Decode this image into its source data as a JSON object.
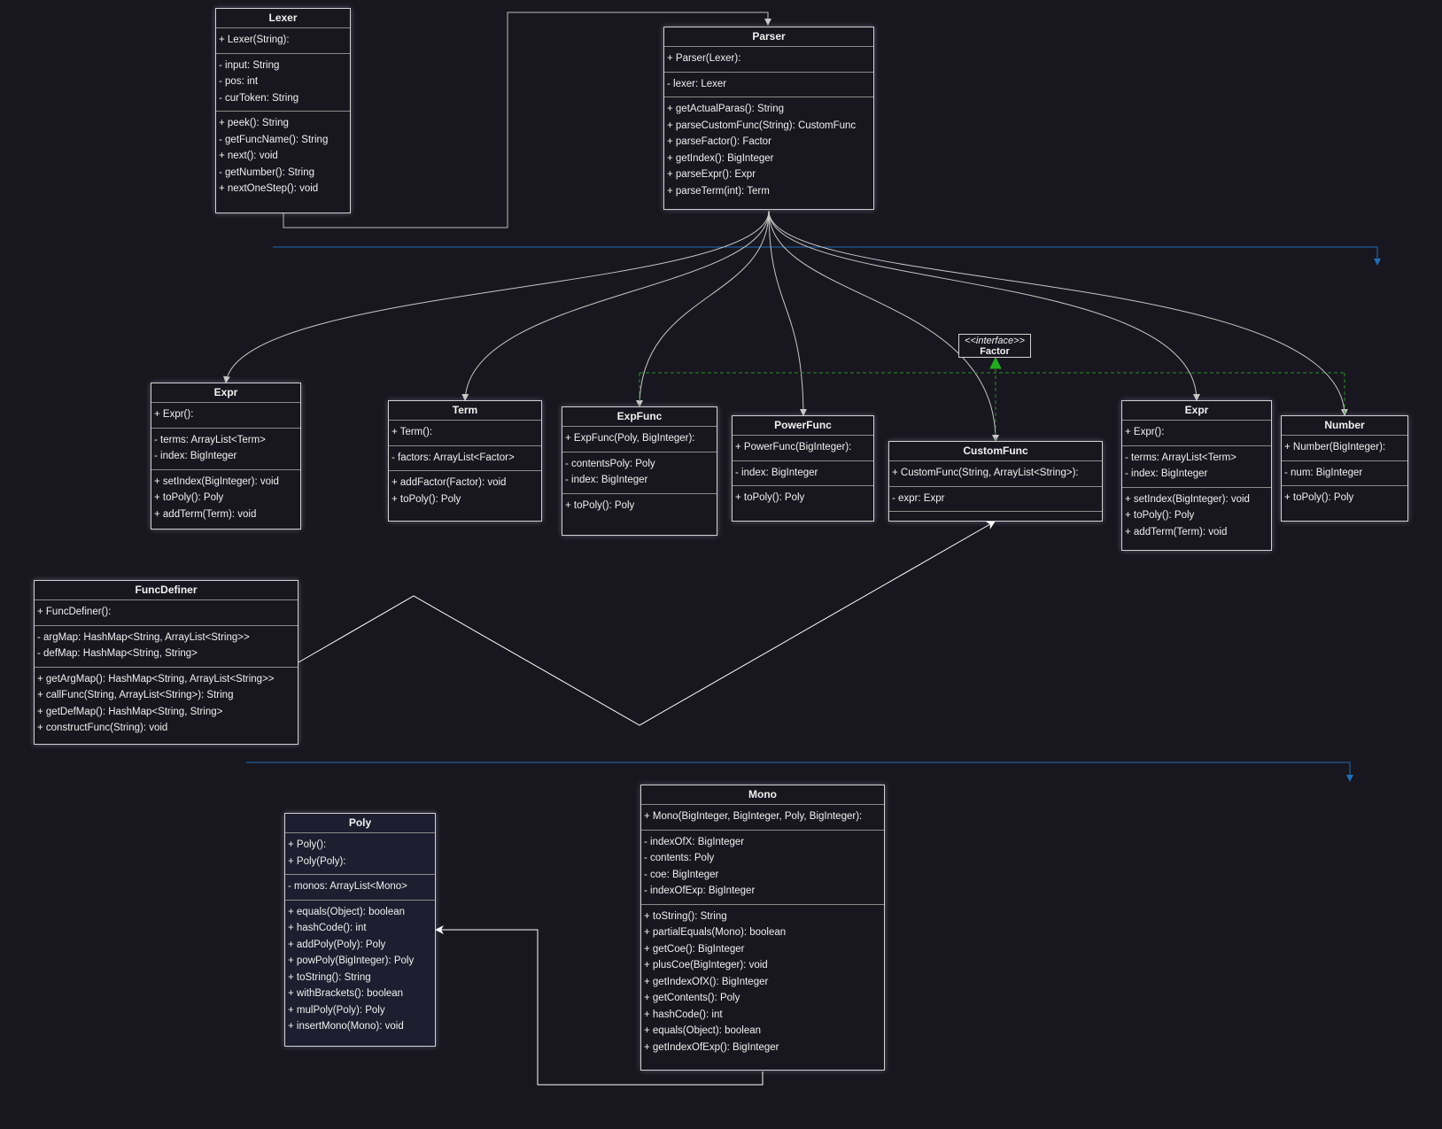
{
  "interface": {
    "stereotype": "<<interface>>",
    "name": "Factor"
  },
  "classes": [
    {
      "name": "Lexer",
      "sections": [
        [
          "+ Lexer(String):"
        ],
        [
          "- input: String",
          "- pos: int",
          "- curToken: String"
        ],
        [
          "+ peek(): String",
          "- getFuncName(): String",
          "+ next(): void",
          "- getNumber(): String",
          "+ nextOneStep(): void"
        ]
      ]
    },
    {
      "name": "Parser",
      "sections": [
        [
          "+ Parser(Lexer):"
        ],
        [
          "- lexer: Lexer"
        ],
        [
          "+ getActualParas(): String",
          "+ parseCustomFunc(String): CustomFunc",
          "+ parseFactor(): Factor",
          "+ getIndex(): BigInteger",
          "+ parseExpr(): Expr",
          "+ parseTerm(int): Term"
        ]
      ]
    },
    {
      "name": "Expr",
      "sections": [
        [
          "+ Expr():"
        ],
        [
          "- terms: ArrayList<Term>",
          "- index: BigInteger"
        ],
        [
          "+ setIndex(BigInteger): void",
          "+ toPoly(): Poly",
          "+ addTerm(Term): void"
        ]
      ]
    },
    {
      "name": "Term",
      "sections": [
        [
          "+ Term():"
        ],
        [
          "- factors: ArrayList<Factor>"
        ],
        [
          "+ addFactor(Factor): void",
          "+ toPoly(): Poly"
        ]
      ]
    },
    {
      "name": "ExpFunc",
      "sections": [
        [
          "+ ExpFunc(Poly, BigInteger):"
        ],
        [
          "- contentsPoly: Poly",
          "- index: BigInteger"
        ],
        [
          "+ toPoly(): Poly"
        ]
      ]
    },
    {
      "name": "PowerFunc",
      "sections": [
        [
          "+ PowerFunc(BigInteger):"
        ],
        [
          "- index: BigInteger"
        ],
        [
          "+ toPoly(): Poly"
        ]
      ]
    },
    {
      "name": "CustomFunc",
      "sections": [
        [
          "+ CustomFunc(String, ArrayList<String>):"
        ],
        [
          "- expr: Expr"
        ],
        []
      ]
    },
    {
      "name": "Expr",
      "sections": [
        [
          "+ Expr():"
        ],
        [
          "- terms: ArrayList<Term>",
          "- index: BigInteger"
        ],
        [
          "+ setIndex(BigInteger): void",
          "+ toPoly(): Poly",
          "+ addTerm(Term): void"
        ]
      ]
    },
    {
      "name": "Number",
      "sections": [
        [
          "+ Number(BigInteger):"
        ],
        [
          "- num: BigInteger"
        ],
        [
          "+ toPoly(): Poly"
        ]
      ]
    },
    {
      "name": "FuncDefiner",
      "sections": [
        [
          "+ FuncDefiner():"
        ],
        [
          "- argMap: HashMap<String, ArrayList<String>>",
          "- defMap: HashMap<String, String>"
        ],
        [
          "+ getArgMap(): HashMap<String, ArrayList<String>>",
          "+ callFunc(String, ArrayList<String>): String",
          "+ getDefMap(): HashMap<String, String>",
          "+ constructFunc(String): void"
        ]
      ]
    },
    {
      "name": "Poly",
      "sections": [
        [
          "+ Poly():",
          "+ Poly(Poly):"
        ],
        [
          "- monos: ArrayList<Mono>"
        ],
        [
          "+ equals(Object): boolean",
          "+ hashCode(): int",
          "+ addPoly(Poly): Poly",
          "+ powPoly(BigInteger): Poly",
          "+ toString(): String",
          "+ withBrackets(): boolean",
          "+ mulPoly(Poly): Poly",
          "+ insertMono(Mono): void"
        ]
      ]
    },
    {
      "name": "Mono",
      "sections": [
        [
          "+ Mono(BigInteger, BigInteger, Poly, BigInteger):"
        ],
        [
          "- indexOfX: BigInteger",
          "- contents: Poly",
          "- coe: BigInteger",
          "- indexOfExp: BigInteger"
        ],
        [
          "+ toString(): String",
          "+ partialEquals(Mono): boolean",
          "+ getCoe(): BigInteger",
          "+ plusCoe(BigInteger): void",
          "+ getIndexOfX(): BigInteger",
          "+ getContents(): Poly",
          "+ hashCode(): int",
          "+ equals(Object): boolean",
          "+ getIndexOfExp(): BigInteger"
        ]
      ]
    }
  ]
}
